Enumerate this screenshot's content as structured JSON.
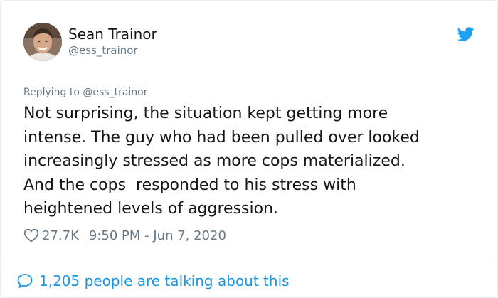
{
  "author": {
    "name": "Sean Trainor",
    "handle": "@ess_trainor",
    "avatar_icon": "profile-photo",
    "platform_icon": "twitter-bird-icon"
  },
  "reply": {
    "text": "Replying to @ess_trainor"
  },
  "tweet": {
    "text": "Not surprising, the situation kept getting more\nintense. The guy who had been pulled over looked\nincreasingly stressed as more cops materialized.\nAnd the cops  responded to his stress with\nheightened levels of aggression."
  },
  "meta": {
    "likes": "27.7K",
    "timestamp": "9:50 PM - Jun 7, 2020",
    "like_icon": "heart-icon"
  },
  "footer": {
    "text": "1,205 people are talking about this",
    "icon": "speech-bubble-icon"
  },
  "colors": {
    "brand": "#1da1f2",
    "link": "#1b95e0",
    "secondary_text": "#657786",
    "primary_text": "#14171a",
    "border": "#e6ecf0"
  }
}
